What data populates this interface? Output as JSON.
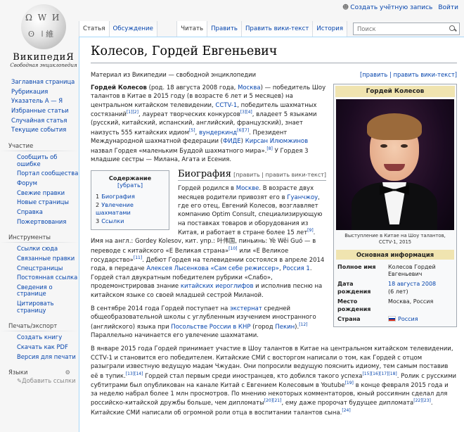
{
  "personal": {
    "create_account": "Создать учётную запись",
    "login": "Войти"
  },
  "logo": {
    "wordmark": "ВикипедиЯ",
    "tagline": "Свободная энциклопедия"
  },
  "tabs": {
    "left": [
      "Статья",
      "Обсуждение"
    ],
    "right": [
      "Читать",
      "Править",
      "Править вики-текст",
      "История"
    ]
  },
  "search": {
    "placeholder": "Поиск"
  },
  "sidebar": {
    "main": [
      "Заглавная страница",
      "Рубрикация",
      "Указатель А — Я",
      "Избранные статьи",
      "Случайная статья",
      "Текущие события"
    ],
    "participation": {
      "heading": "Участие",
      "items": [
        "Сообщить об ошибке",
        "Портал сообщества",
        "Форум",
        "Свежие правки",
        "Новые страницы",
        "Справка",
        "Пожертвования"
      ]
    },
    "tools": {
      "heading": "Инструменты",
      "items": [
        "Ссылки сюда",
        "Связанные правки",
        "Спецстраницы",
        "Постоянная ссылка",
        "Сведения о странице",
        "Цитировать страницу"
      ]
    },
    "print": {
      "heading": "Печать/экспорт",
      "items": [
        "Создать книгу",
        "Скачать как PDF",
        "Версия для печати"
      ]
    },
    "languages": {
      "heading": "Языки",
      "add": "Добавить ссылки"
    }
  },
  "article": {
    "title": "Колесов, Гордей Евгеньевич",
    "from": "Материал из Википедии — свободной энциклопедии",
    "top_edit": "[править | править вики-текст]",
    "intro": {
      "name": "Гордей Колесов",
      "t1": " (род. 18 августа 2008 года, ",
      "link_moscow": "Москва",
      "t2": ") — победитель Шоу талантов в Китае в 2015 году (в возрасте 6 лет и 5 месяцев) на центральном китайском телевидении, ",
      "link_cctv": "CCTV-1",
      "t3": ", победитель шахматных состязаний",
      "r1": "[1][2]",
      "t4": ", лауреат творческих конкурсов",
      "r2": "[3][4]",
      "t5": ", владеет 5 языками (русский, китайский, испанский, английский, французский), знает наизусть 555 китайских идиом",
      "r3": "[5]",
      "t6": ", ",
      "link_prodigy": "вундеркинд",
      "r4": "[6][7]",
      "t7": ". Президент Международной шахматной федерации (",
      "link_fide": "ФИДЕ",
      "t8": ") ",
      "link_ilyumzhinov": "Кирсан Илюмжинов",
      "t9": " назвал Гордея «маленьким Буддой шахматного мира».",
      "r5": "[8]",
      "t10": " У Гордея 3 младшие сестры — Милана, Агата и Есения."
    },
    "infobox": {
      "title": "Гордей Колесов",
      "caption": "Выступление в Китае на Шоу талантов, CCTV-1, 2015",
      "section": "Основная информация",
      "rows": [
        {
          "label": "Полное имя",
          "value": "Колесов Гордей Евгеньевич"
        },
        {
          "label": "Дата рождения",
          "value": "18 августа 2008",
          "extra": "(6 лет)"
        },
        {
          "label": "Место рождения",
          "value": "Москва, Россия"
        },
        {
          "label": "Страна",
          "value": "Россия"
        }
      ]
    },
    "toc": {
      "title": "Содержание",
      "toggle": "[убрать]",
      "items": [
        {
          "num": "1",
          "label": "Биография"
        },
        {
          "num": "2",
          "label": "Увлечение шахматами"
        },
        {
          "num": "3",
          "label": "Ссылки"
        }
      ]
    },
    "biography": {
      "heading": "Биография",
      "edit": "[править | править вики-текст]",
      "p1": {
        "t1": "Гордей родился в ",
        "link_moscow": "Москве",
        "t2": ". В возрасте двух месяцев родители привозят его в ",
        "link_guangzhou": "Гуанчжоу",
        "t3": ", где его отец, Евгений Колесов, возглавляет компанию Optim Consult, специализирующую на поставках товаров и оборудования из Китая, и работает в стране более 15 лет",
        "r1": "[9]",
        "t4": ". Имя на англ.: Gordey Kolesov, кит. упр.: 叶伟国, пиньинь: Yè Wěi Guó — в переводе с китайского «Е Великая страна»",
        "r2": "[10]",
        "t5": " или «Е Великое государство»",
        "r3": "[11]",
        "t6": ". Дебют Гордея на телевидении состоялся в апреле 2014 года, в передаче ",
        "link_lysenkova": "Алексея Лысенкова «Сам себе режиссер»",
        "t7": ", ",
        "link_russia1": "Россия 1",
        "t8": ". Гордей стал двукратным победителем рубрики «Слабо», продемонстрировав знание ",
        "link_hieroglyphs": "китайских иероглифов",
        "t9": " и исполнив песню на китайском языке со своей младшей сестрой Миланой."
      },
      "p2": {
        "t1": "В сентябре 2014 года Гордей поступает на ",
        "link_external": "экстернат",
        "t2": " средней общеобразовательной школы с углубленным изучением иностранного (английского) языка при ",
        "link_embassy": "Посольстве России в КНР",
        "t3": " (город ",
        "link_beijing": "Пекин",
        "t4": ").",
        "r1": "[12]",
        "t5": " Параллельно начинается его увлечение шахматами."
      },
      "p3": {
        "t1": "В январе 2015 года Гордей принимает участие в Шоу талантов в Китае на центральном китайском телевидении, CCTV-1 и становится его победителем. Китайские СМИ с восторгом написали о том, как Гордей с отцом разыграли известную ведущую мадам Чжудан. Они попросили ведущую пояснить идиому, тем самым поставив её в тупик.",
        "r1": "[13][14]",
        "t2": " Гордей стал первым среди иностранцев, кто добился такого успеха",
        "r2": "[15][16][17][18]",
        "t3": ". Ролик с русскими субтитрами был опубликован на канале Китай с Евгением Колесовым в Youtube",
        "r3": "[19]",
        "t4": " в конце февраля 2015 года и за неделю набрал более 1 млн просмотров. По мнению некоторых комментаторов, юный россиянин сделал для российско-китайской дружбы больше, чем дипломаты",
        "r4": "[20][21]",
        "t5": ", ему даже пророчат будущее дипломата",
        "r5": "[22][23]",
        "t6": ". Китайские СМИ написали об огромной роли отца в воспитании талантов сына.",
        "r6": "[24]"
      }
    }
  }
}
